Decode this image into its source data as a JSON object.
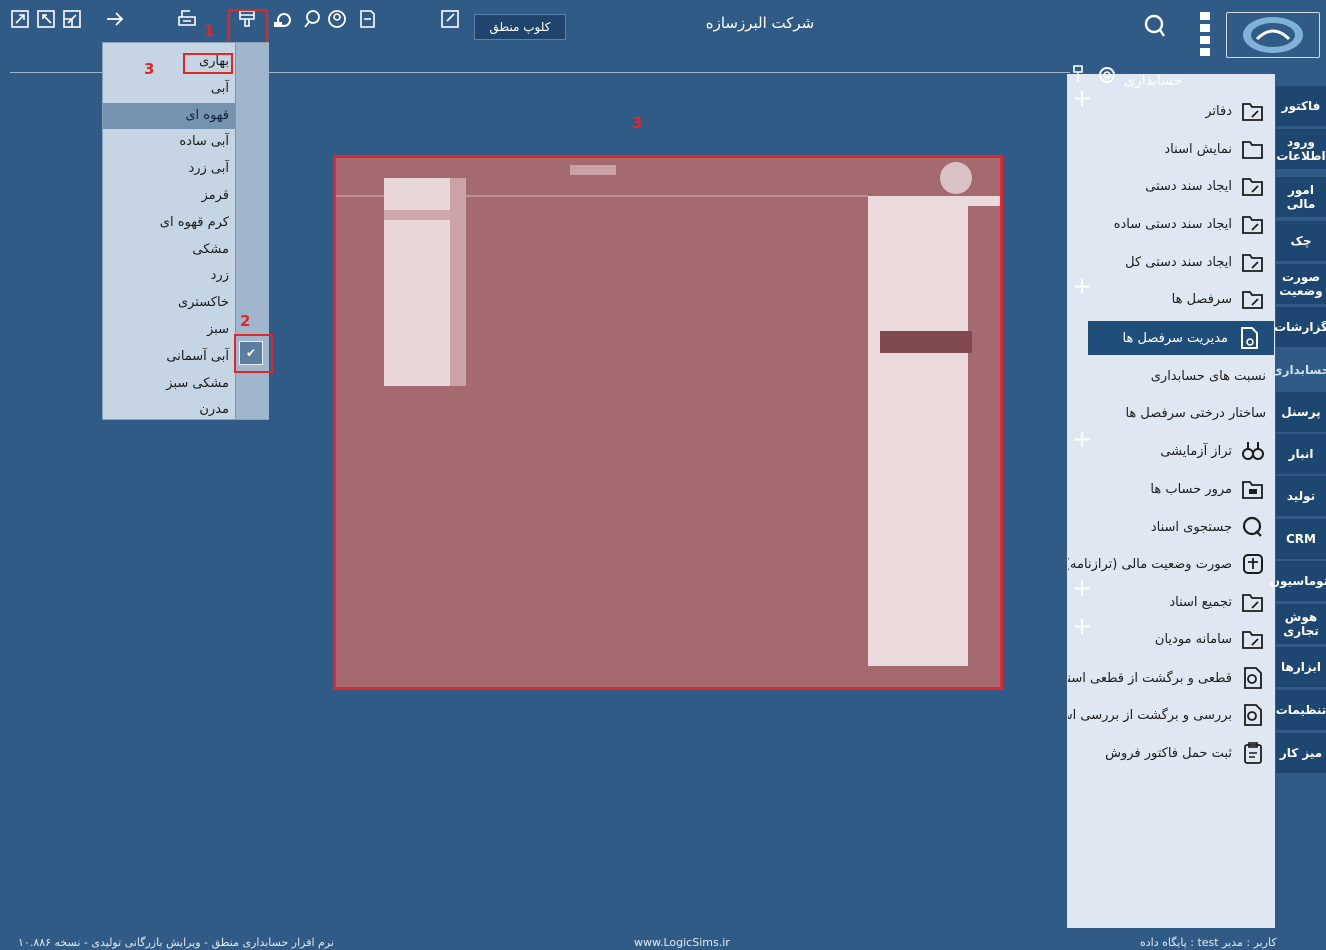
{
  "header": {
    "company": "شرکت البرزسازه",
    "club_button": "کلوپ منطق"
  },
  "annotations": {
    "one": "1",
    "two": "2",
    "three_menu": "3",
    "three_preview": "3"
  },
  "theme_menu": {
    "items": [
      "بهاری",
      "آبی",
      "قهوه ای",
      "آبی ساده",
      "آبی زرد",
      "قرمز",
      "کرم قهوه ای",
      "مشکی",
      "زرد",
      "خاکستری",
      "سبز",
      "آبی آسمانی",
      "مشکی سبز",
      "مدرن"
    ],
    "selected": "قهوه ای",
    "checked": "آبی آسمانی"
  },
  "panel": {
    "title": "حسابداری",
    "items": [
      {
        "label": "دفاتر",
        "icon": "folder-edit-icon"
      },
      {
        "label": "نمایش اسناد",
        "icon": "folder-icon"
      },
      {
        "label": "ایجاد سند دستی",
        "icon": "folder-edit-icon"
      },
      {
        "label": "ایجاد سند دستی ساده",
        "icon": "folder-edit-icon"
      },
      {
        "label": "ایجاد سند دستی کل",
        "icon": "folder-edit-icon"
      },
      {
        "label": "سرفصل ها",
        "icon": "folder-edit-icon"
      },
      {
        "label": "مدیریت سرفصل ها",
        "icon": "document-gear-icon"
      },
      {
        "label": "نسبت های حسابداری",
        "icon": ""
      },
      {
        "label": "ساختار درختی سرفصل ها",
        "icon": ""
      },
      {
        "label": "تراز آزمایشی",
        "icon": "binoculars-icon"
      },
      {
        "label": "مرور حساب ها",
        "icon": "folder-review-icon"
      },
      {
        "label": "جستجوی اسناد",
        "icon": "search-doc-icon"
      },
      {
        "label": "صورت وضعیت مالی (ترازنامه)",
        "icon": "balance-icon"
      },
      {
        "label": "تجمیع اسناد",
        "icon": "folder-edit-icon"
      },
      {
        "label": "سامانه مودیان",
        "icon": "folder-edit-icon"
      },
      {
        "label": "قطعی و برگشت از قطعی اسناد",
        "icon": "doc-search-icon"
      },
      {
        "label": "بررسی و برگشت از بررسی اسناد",
        "icon": "doc-search-icon"
      },
      {
        "label": "ثبت حمل فاکتور فروش",
        "icon": "clipboard-icon"
      }
    ]
  },
  "tabs": [
    "فاکتور",
    "ورود اطلاعات",
    "امور مالی",
    "چک",
    "صورت وضعیت",
    "گزارشات",
    "حسابداری",
    "پرسنل",
    "انبار",
    "تولید",
    "CRM",
    "اتوماسیون",
    "هوش تجاری",
    "ابزارها",
    "تنظیمات",
    "میز کار"
  ],
  "status": {
    "left": "نرم افزار حسابداری منطق - ویرایش بازرگانی تولیدی - نسخه ۱۰.۸۸۶",
    "center": "www.LogicSims.ir",
    "right": "پایگاه داده : test     کاربر : مدیر"
  }
}
